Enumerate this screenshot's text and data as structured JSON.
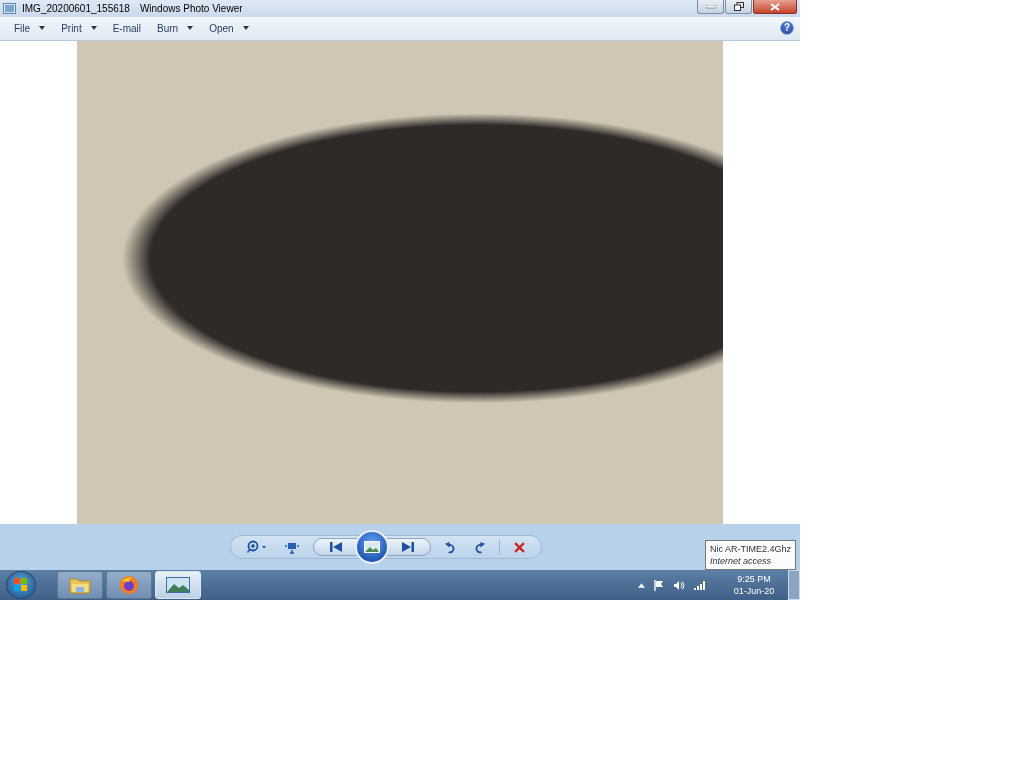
{
  "window": {
    "file_name": "IMG_20200601_155618",
    "app_name": "Windows Photo Viewer"
  },
  "menu": [
    {
      "label": "File",
      "has_dropdown": true
    },
    {
      "label": "Print",
      "has_dropdown": true
    },
    {
      "label": "E-mail",
      "has_dropdown": false
    },
    {
      "label": "Burn",
      "has_dropdown": true
    },
    {
      "label": "Open",
      "has_dropdown": true
    }
  ],
  "help": {
    "label": "?"
  },
  "taskbar": {
    "apps": [
      {
        "kind": "folder",
        "selected": false
      },
      {
        "kind": "browser",
        "selected": false
      },
      {
        "kind": "photos",
        "selected": true
      }
    ],
    "tooltip": {
      "network": "Nic AR-TIME2.4Ghz",
      "status": "Internet access"
    },
    "clock": {
      "time": "9:25 PM",
      "date": "01-Jun-20"
    }
  }
}
